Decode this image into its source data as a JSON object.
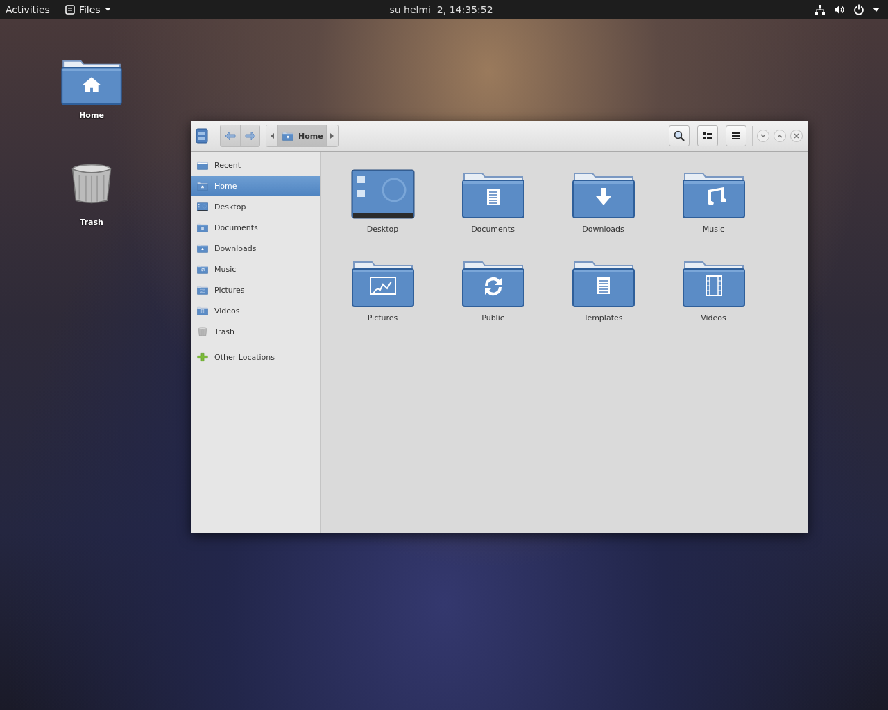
{
  "top_bar": {
    "activities": "Activities",
    "app_menu": "Files",
    "clock": "su helmi  2, 14:35:52"
  },
  "desktop_icons": [
    {
      "label": "Home",
      "kind": "home"
    },
    {
      "label": "Trash",
      "kind": "trash"
    }
  ],
  "window": {
    "path_button": "Home"
  },
  "sidebar": {
    "items": [
      {
        "label": "Recent",
        "kind": "recent",
        "selected": false
      },
      {
        "label": "Home",
        "kind": "home",
        "selected": true
      },
      {
        "label": "Desktop",
        "kind": "desktop",
        "selected": false
      },
      {
        "label": "Documents",
        "kind": "documents",
        "selected": false
      },
      {
        "label": "Downloads",
        "kind": "downloads",
        "selected": false
      },
      {
        "label": "Music",
        "kind": "music",
        "selected": false
      },
      {
        "label": "Pictures",
        "kind": "pictures",
        "selected": false
      },
      {
        "label": "Videos",
        "kind": "videos",
        "selected": false
      },
      {
        "label": "Trash",
        "kind": "trash",
        "selected": false
      }
    ],
    "other_locations": "Other Locations"
  },
  "files": [
    {
      "label": "Desktop",
      "kind": "desktop"
    },
    {
      "label": "Documents",
      "kind": "documents"
    },
    {
      "label": "Downloads",
      "kind": "downloads"
    },
    {
      "label": "Music",
      "kind": "music"
    },
    {
      "label": "Pictures",
      "kind": "pictures"
    },
    {
      "label": "Public",
      "kind": "public"
    },
    {
      "label": "Templates",
      "kind": "templates"
    },
    {
      "label": "Videos",
      "kind": "videos"
    }
  ]
}
